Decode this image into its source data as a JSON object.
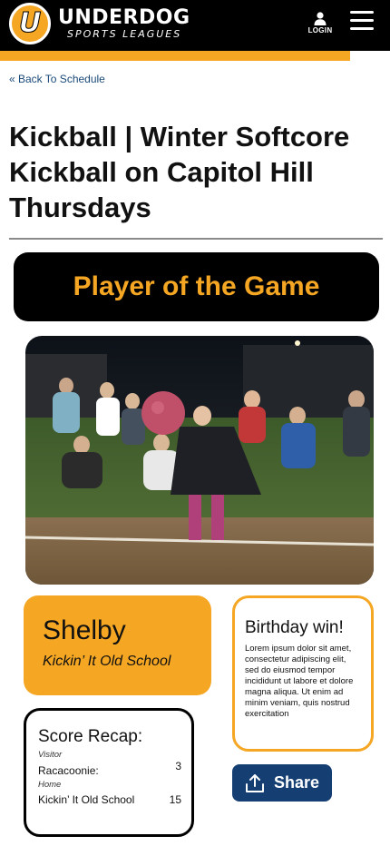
{
  "header": {
    "logo_letter": "U",
    "logo_main": "UNDERDOG",
    "logo_sub": "SPORTS LEAGUES",
    "login_label": "LOGIN",
    "menu_icon": "hamburger-menu-icon"
  },
  "back_link": "« Back To Schedule",
  "page_title": "Kickball | Winter Softcore Kickball on Capitol Hill Thursdays",
  "banner": "Player of the Game",
  "player": {
    "name": "Shelby",
    "team": "Kickin’ It Old School"
  },
  "birthday": {
    "title": "Birthday win!",
    "body": "Lorem ipsum dolor sit amet, consectetur adipiscing elit, sed do eiusmod tempor incididunt ut labore et dolore magna aliqua. Ut enim ad minim veniam, quis nostrud exercitation"
  },
  "score": {
    "title": "Score Recap:",
    "visitor_label": "Visitor",
    "visitor_team": "Racacoonie:",
    "visitor_score": "3",
    "home_label": "Home",
    "home_team": "Kickin’ It Old School",
    "home_score": "15"
  },
  "share_label": "Share",
  "colors": {
    "brand_orange": "#f5a623",
    "header_black": "#000000",
    "share_blue": "#153f73",
    "link_blue": "#1a4a7a"
  }
}
